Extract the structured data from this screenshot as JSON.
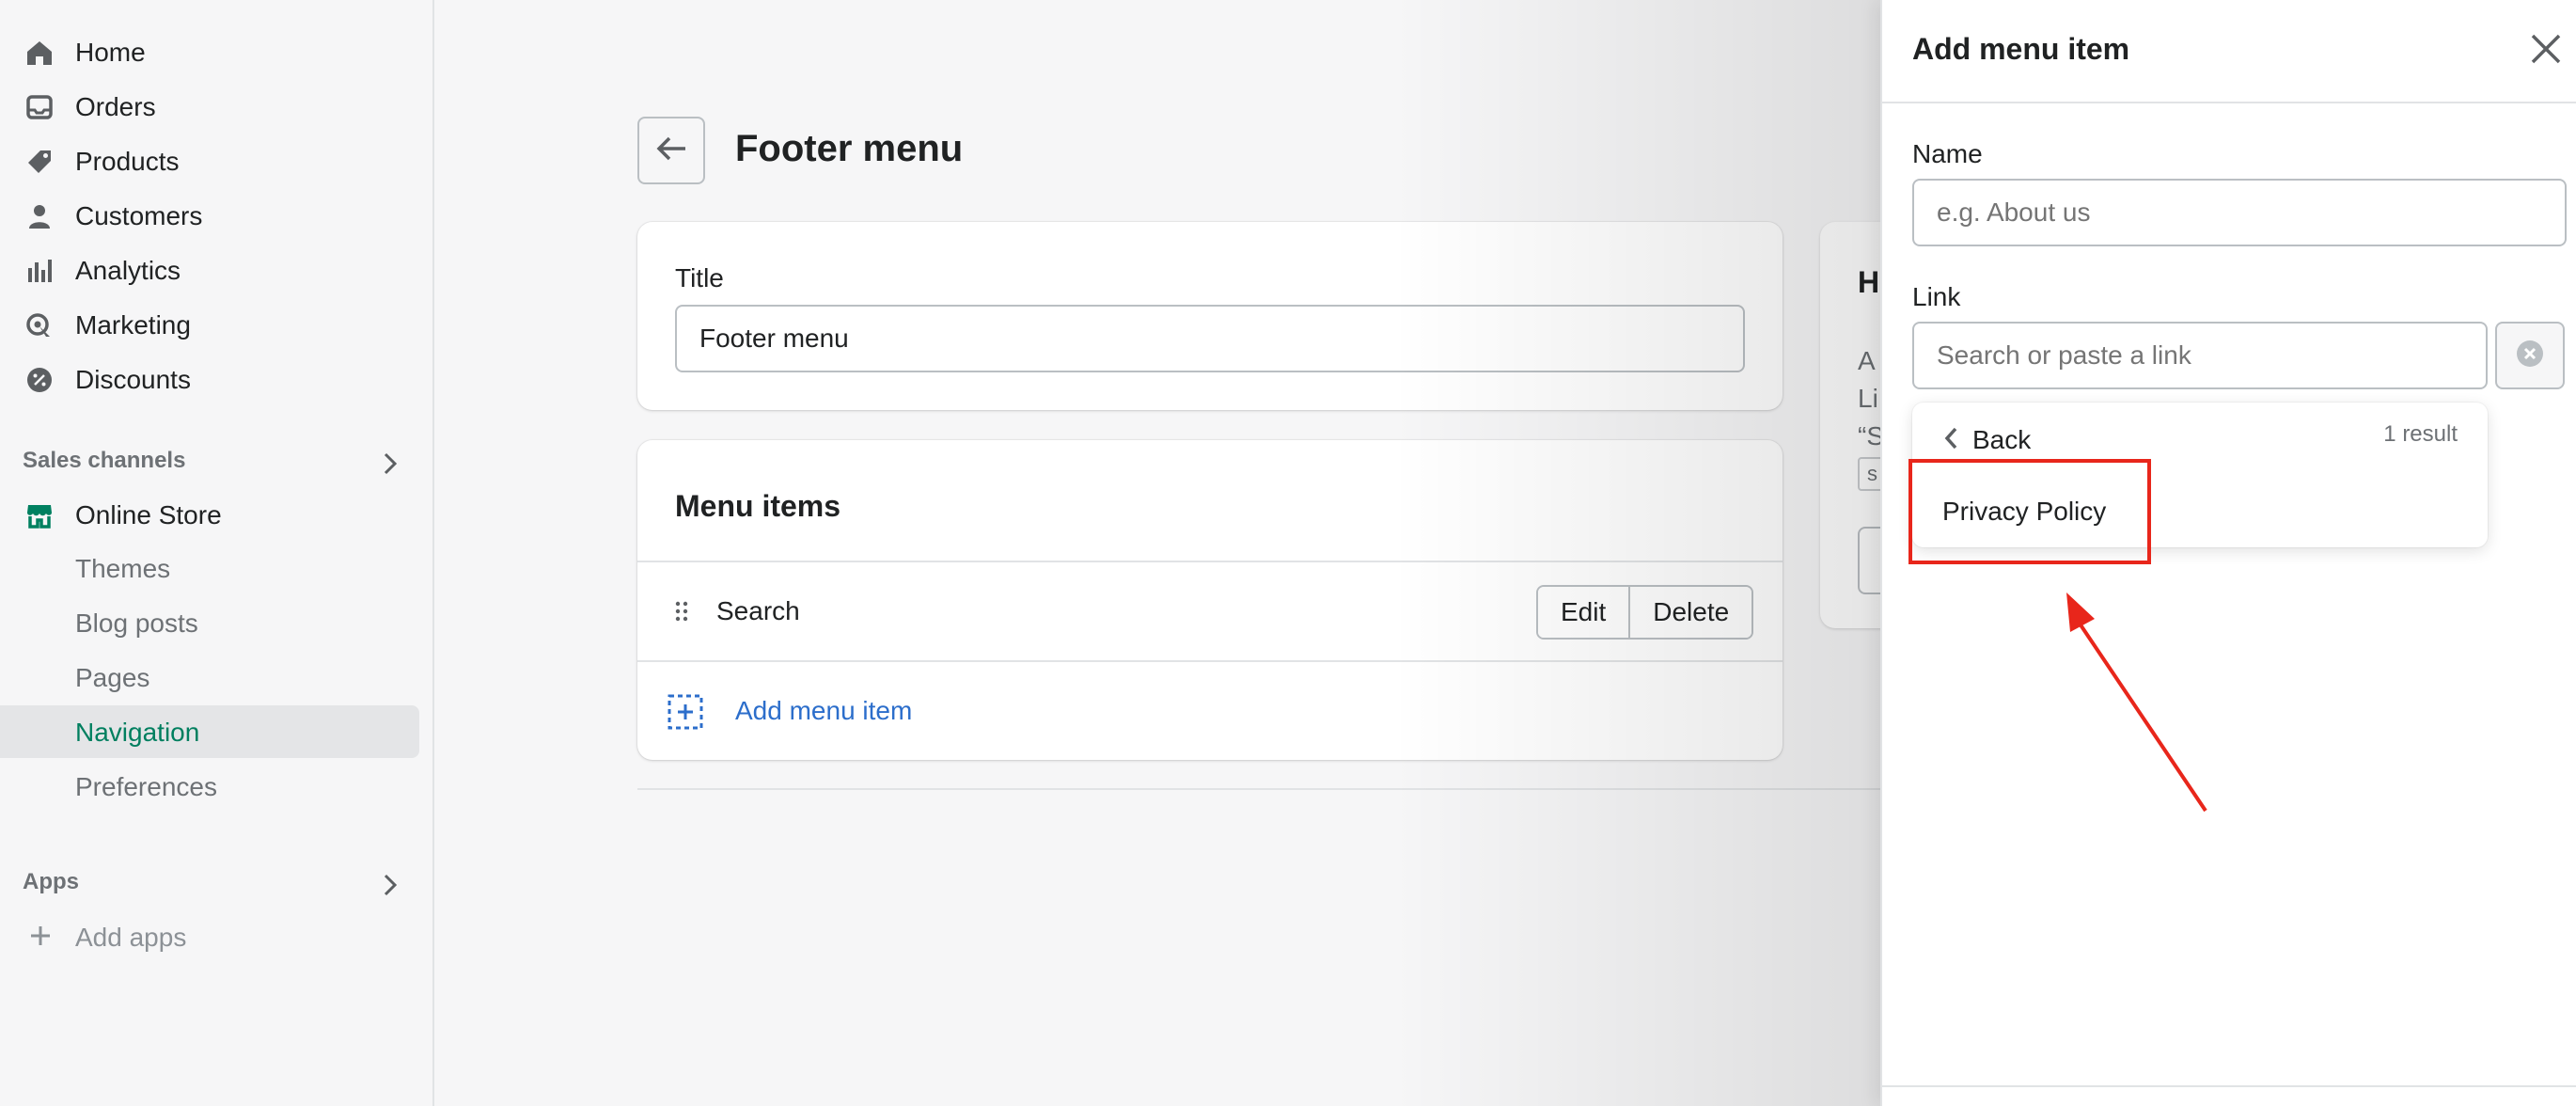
{
  "sidebar": {
    "items": [
      {
        "label": "Home",
        "icon": "home-icon"
      },
      {
        "label": "Orders",
        "icon": "inbox-icon"
      },
      {
        "label": "Products",
        "icon": "tag-icon"
      },
      {
        "label": "Customers",
        "icon": "person-icon"
      },
      {
        "label": "Analytics",
        "icon": "bar-chart-icon"
      },
      {
        "label": "Marketing",
        "icon": "target-icon"
      },
      {
        "label": "Discounts",
        "icon": "discount-icon"
      }
    ],
    "sales_channels_label": "Sales channels",
    "online_store": {
      "label": "Online Store",
      "icon": "store-icon",
      "color": "#008060"
    },
    "online_store_subitems": [
      {
        "label": "Themes"
      },
      {
        "label": "Blog posts"
      },
      {
        "label": "Pages"
      },
      {
        "label": "Navigation",
        "active": true
      },
      {
        "label": "Preferences"
      }
    ],
    "apps_label": "Apps",
    "add_apps_label": "Add apps"
  },
  "main": {
    "page_title": "Footer menu",
    "title_card": {
      "label": "Title",
      "value": "Footer menu"
    },
    "menu_items_card": {
      "heading": "Menu items",
      "items": [
        {
          "label": "Search"
        }
      ],
      "edit_label": "Edit",
      "delete_label": "Delete",
      "add_label": "Add menu item"
    },
    "help_card": {
      "heading": "H",
      "lines": [
        "A",
        "Li",
        "“S"
      ],
      "chip": "s"
    }
  },
  "panel": {
    "title": "Add menu item",
    "name_label": "Name",
    "name_placeholder": "e.g. About us",
    "link_label": "Link",
    "link_placeholder": "Search or paste a link",
    "dropdown": {
      "back_label": "Back",
      "result_count": "1 result",
      "options": [
        {
          "label": "Privacy Policy"
        }
      ]
    }
  },
  "colors": {
    "accent_link": "#2c6ecb",
    "active_nav": "#007f5f",
    "annotation": "#e8261b"
  }
}
